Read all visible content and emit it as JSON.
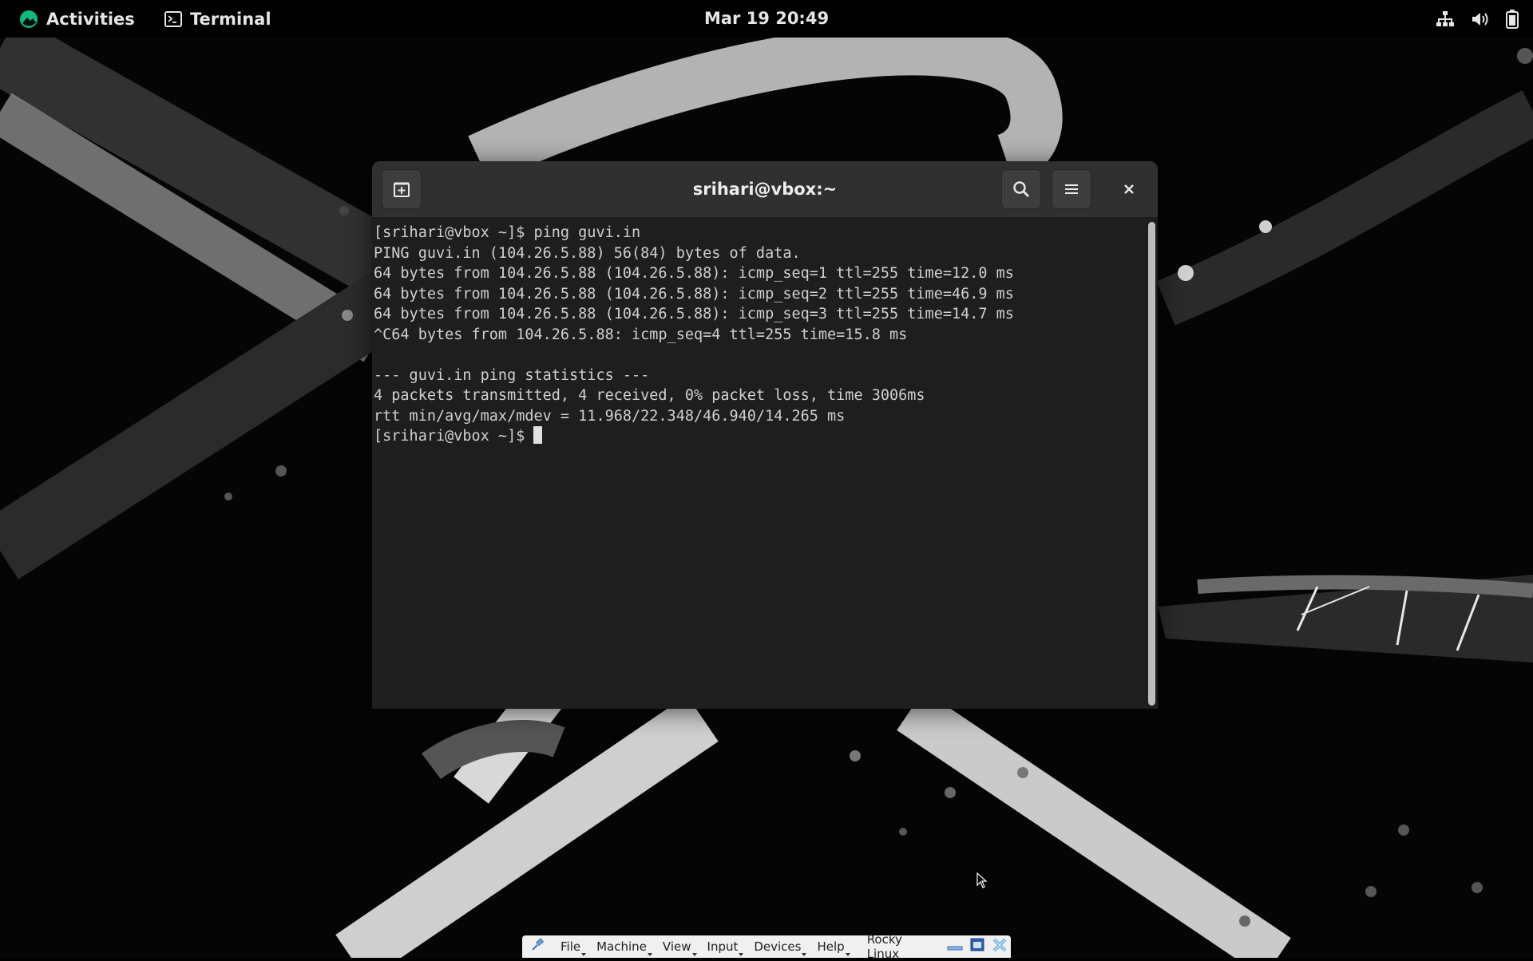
{
  "topbar": {
    "activities_label": "Activities",
    "app_label": "Terminal",
    "clock": "Mar 19  20:49",
    "tray_icons": [
      "network-icon",
      "volume-icon",
      "battery-icon"
    ]
  },
  "window": {
    "title": "srihari@vbox:~",
    "new_tab_icon": "new-tab-icon",
    "search_icon": "search-icon",
    "menu_icon": "hamburger-menu-icon",
    "close_icon": "close-icon"
  },
  "terminal": {
    "lines": [
      "[srihari@vbox ~]$ ping guvi.in",
      "PING guvi.in (104.26.5.88) 56(84) bytes of data.",
      "64 bytes from 104.26.5.88 (104.26.5.88): icmp_seq=1 ttl=255 time=12.0 ms",
      "64 bytes from 104.26.5.88 (104.26.5.88): icmp_seq=2 ttl=255 time=46.9 ms",
      "64 bytes from 104.26.5.88 (104.26.5.88): icmp_seq=3 ttl=255 time=14.7 ms",
      "^C64 bytes from 104.26.5.88: icmp_seq=4 ttl=255 time=15.8 ms",
      "",
      "--- guvi.in ping statistics ---",
      "4 packets transmitted, 4 received, 0% packet loss, time 3006ms",
      "rtt min/avg/max/mdev = 11.968/22.348/46.940/14.265 ms"
    ],
    "prompt": "[srihari@vbox ~]$ "
  },
  "vbox_menu": {
    "items": [
      "File",
      "Machine",
      "View",
      "Input",
      "Devices",
      "Help"
    ],
    "vm_name": "Rocky Linux"
  },
  "colors": {
    "terminal_bg": "#1e1e1e",
    "headerbar_bg": "#303030",
    "rocky_green": "#10b981"
  }
}
